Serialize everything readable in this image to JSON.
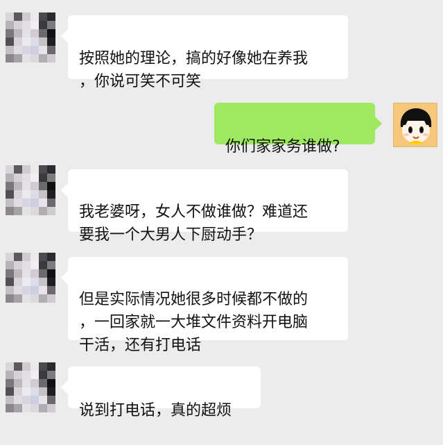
{
  "chat": {
    "messages": [
      {
        "side": "left",
        "text": "按照她的理论，搞的好像她在养我\n，你说可笑不可笑"
      },
      {
        "side": "right",
        "text": "你们家家务谁做?"
      },
      {
        "side": "left",
        "text": "我老婆呀，女人不做谁做？难道还\n要我一个大男人下厨动手？"
      },
      {
        "side": "left",
        "text": "但是实际情况她很多时候都不做的\n，一回家就一大堆文件资料开电脑\n干活，还有打电话"
      },
      {
        "side": "left",
        "text": "说到打电话，真的超烦"
      }
    ]
  },
  "colors": {
    "background": "#ececec",
    "left_bubble": "#ffffff",
    "right_bubble": "#9fe862",
    "text": "#111111"
  },
  "icons": {
    "left_avatar": "pixelated-avatar-icon",
    "right_avatar": "cartoon-girl-avatar-icon"
  }
}
